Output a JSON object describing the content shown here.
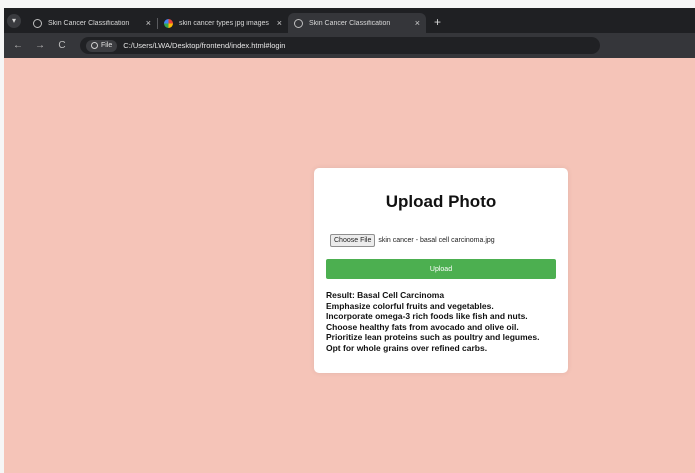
{
  "browser": {
    "tabs": [
      {
        "label": "Skin Cancer Classification",
        "close": "×",
        "icon": "globe-icon"
      },
      {
        "label": "skin cancer types jpg images",
        "close": "×",
        "icon": "google-icon"
      },
      {
        "label": "Skin Cancer Classification",
        "close": "×",
        "icon": "globe-icon"
      }
    ],
    "new_tab": "+",
    "nav": {
      "back": "←",
      "forward": "→",
      "reload": "C"
    },
    "address": {
      "chip": "File",
      "url": "C:/Users/LWA/Desktop/frontend/index.html#login"
    }
  },
  "card": {
    "title": "Upload Photo",
    "choose_label": "Choose File",
    "file_name": "skin cancer - basal cell carcinoma.jpg",
    "upload_label": "Upload",
    "result_lines": [
      "Result: Basal Cell Carcinoma",
      "Emphasize colorful fruits and vegetables.",
      "Incorporate omega-3 rich foods like fish and nuts.",
      "Choose healthy fats from avocado and olive oil.",
      "Prioritize lean proteins such as poultry and legumes.",
      "Opt for whole grains over refined carbs."
    ]
  },
  "colors": {
    "page_background": "#f5c4b8",
    "upload_button": "#4caf50"
  }
}
